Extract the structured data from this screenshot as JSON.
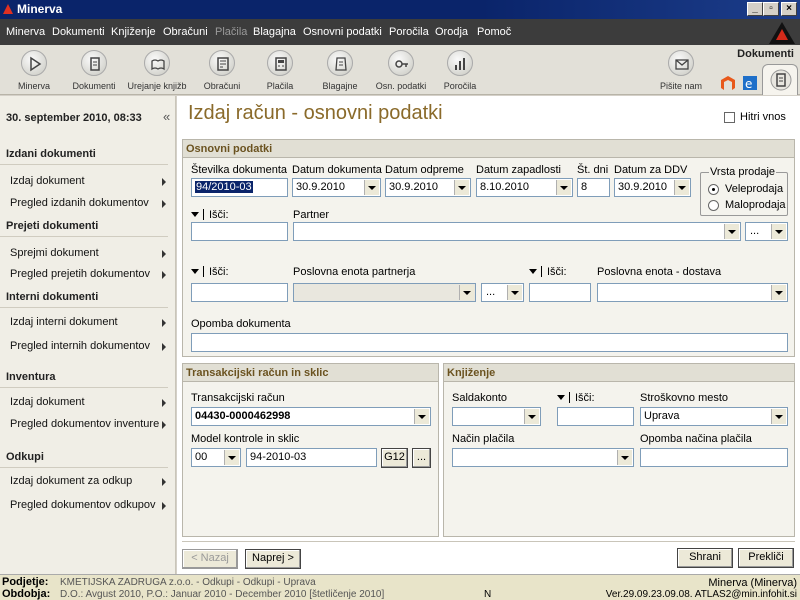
{
  "window": {
    "title": "Minerva"
  },
  "menu": [
    "Minerva",
    "Dokumenti",
    "Knjiženje",
    "Obračuni",
    "Plačila",
    "Blagajna",
    "Osnovni podatki",
    "Poročila",
    "Orodja",
    "Pomoč"
  ],
  "toolbar": {
    "items": [
      "Minerva",
      "Dokumenti",
      "Urejanje knjižb",
      "Obračuni",
      "Plačila",
      "Blagajne",
      "Osn. podatki",
      "Poročila"
    ],
    "write_us": "Pišite nam",
    "section_title": "Dokumenti"
  },
  "sidebar": {
    "datetime": "30. september 2010, 08:33",
    "collapse": "«",
    "sections": [
      {
        "title": "Izdani dokumenti",
        "items": [
          "Izdaj dokument",
          "Pregled izdanih dokumentov"
        ]
      },
      {
        "title": "Prejeti dokumenti",
        "items": [
          "Sprejmi dokument",
          "Pregled prejetih dokumentov"
        ]
      },
      {
        "title": "Interni dokumenti",
        "items": [
          "Izdaj interni dokument",
          "Pregled internih dokumentov"
        ]
      },
      {
        "title": "Inventura",
        "items": [
          "Izdaj dokument",
          "Pregled dokumentov inventure"
        ]
      },
      {
        "title": "Odkupi",
        "items": [
          "Izdaj dokument za odkup",
          "Pregled dokumentov odkupov"
        ]
      }
    ]
  },
  "page": {
    "title": "Izdaj račun - osnovni podatki",
    "fast_entry": "Hitri vnos"
  },
  "basic": {
    "header": "Osnovni podatki",
    "doc_number_label": "Številka dokumenta",
    "doc_number": "94/2010-03",
    "doc_date_label": "Datum dokumenta",
    "doc_date": "30.9.2010",
    "ship_date_label": "Datum odpreme",
    "ship_date": "30.9.2010",
    "due_date_label": "Datum zapadlosti",
    "due_date": "8.10.2010",
    "days_label": "Št. dni",
    "days": "8",
    "vat_date_label": "Datum za DDV",
    "vat_date": "30.9.2010",
    "sale_type_label": "Vrsta prodaje",
    "sale_types": [
      "Veleprodaja",
      "Maloprodaja"
    ],
    "search_label": "Išči:",
    "partner_label": "Partner",
    "partner": "",
    "ellipsis": "...",
    "business_unit_label": "Poslovna enota partnerja",
    "delivery_unit_label": "Poslovna enota - dostava",
    "note_label": "Opomba dokumenta",
    "note": ""
  },
  "transaction": {
    "header": "Transakcijski račun in sklic",
    "account_label": "Transakcijski račun",
    "account": "04430-0000462998",
    "model_label": "Model kontrole in sklic",
    "model": "00",
    "reference": "94-2010-03",
    "g12": "G12",
    "ellipsis": "..."
  },
  "posting": {
    "header": "Knjiženje",
    "saldokonto_label": "Saldakonto",
    "search_label": "Išči:",
    "cost_center_label": "Stroškovno mesto",
    "cost_center": "Uprava",
    "payment_method_label": "Način plačila",
    "payment_note_label": "Opomba načina plačila"
  },
  "buttons": {
    "back": "< Nazaj",
    "next": "Naprej >",
    "save": "Shrani",
    "cancel": "Prekliči"
  },
  "status": {
    "company_key": "Podjetje:",
    "company": "KMETIJSKA ZADRUGA z.o.o. - Odkupi - Odkupi - Uprava",
    "period_key": "Obdobja:",
    "period": "D.O.: Avgust 2010, P.O.: Januar 2010 - December 2010 [štetličenje 2010]",
    "mode": "N",
    "app": "Minerva (Minerva)",
    "version": "Ver.29.09.23.09.08. ATLAS2@min.infohit.si"
  }
}
